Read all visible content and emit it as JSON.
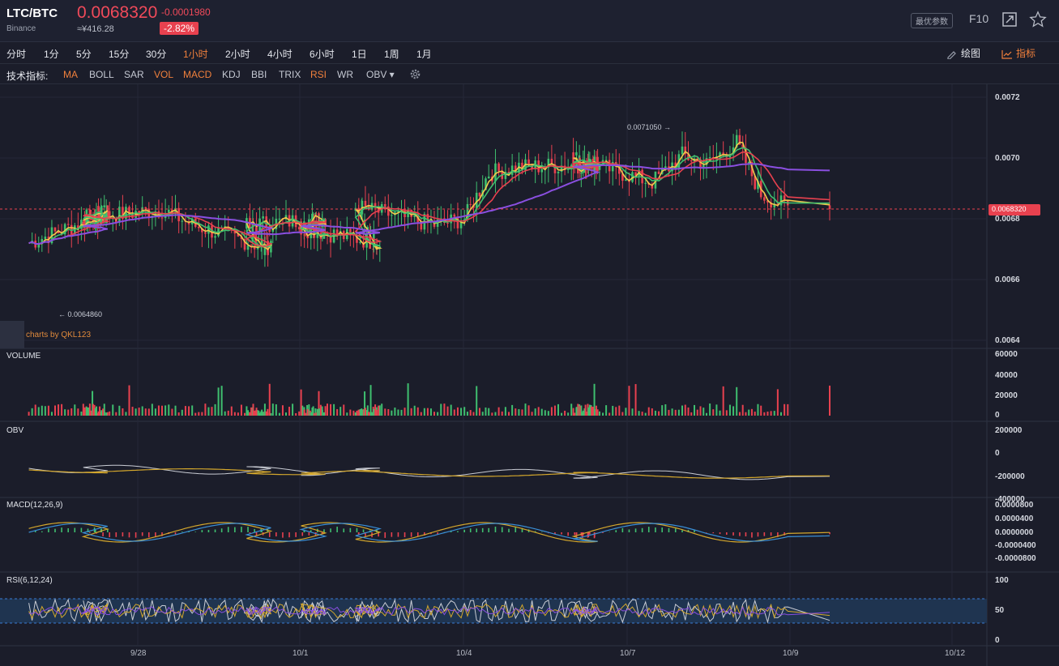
{
  "header": {
    "pair": "LTC/BTC",
    "exchange": "Binance",
    "price": "0.0068320",
    "cny_price": "≈¥416.28",
    "change_abs": "-0.0001980",
    "change_pct": "-2.82%",
    "params_label": "最优参数",
    "f10_label": "F10",
    "icons": [
      "expand-icon",
      "star-icon"
    ]
  },
  "timeframes": [
    {
      "label": "分时",
      "active": false
    },
    {
      "label": "1分",
      "active": false
    },
    {
      "label": "5分",
      "active": false
    },
    {
      "label": "15分",
      "active": false
    },
    {
      "label": "30分",
      "active": false
    },
    {
      "label": "1小时",
      "active": true
    },
    {
      "label": "2小时",
      "active": false
    },
    {
      "label": "4小时",
      "active": false
    },
    {
      "label": "6小时",
      "active": false
    },
    {
      "label": "1日",
      "active": false
    },
    {
      "label": "1周",
      "active": false
    },
    {
      "label": "1月",
      "active": false
    }
  ],
  "tools": {
    "draw_label": "绘图",
    "indicator_label": "指标",
    "draw_icon": "pencil-icon",
    "indicator_icon": "chart-line-icon"
  },
  "indicators": {
    "label": "技术指标:",
    "items": [
      {
        "name": "MA",
        "on": true
      },
      {
        "name": "BOLL",
        "on": false
      },
      {
        "name": "SAR",
        "on": false
      },
      {
        "name": "VOL",
        "on": true
      },
      {
        "name": "MACD",
        "on": true
      },
      {
        "name": "KDJ",
        "on": false
      },
      {
        "name": "BBI",
        "on": false
      },
      {
        "name": "TRIX",
        "on": false
      },
      {
        "name": "RSI",
        "on": true
      },
      {
        "name": "WR",
        "on": false
      },
      {
        "name": "OBV ▾",
        "on": false
      }
    ],
    "settings_icon": "gear-icon"
  },
  "main_chart": {
    "price_axis": [
      "0.0072",
      "0.0070",
      "0.0068",
      "0.0066",
      "0.0064"
    ],
    "current_price_tag": "0.0068320",
    "high_annotation": "0.0071050 →",
    "low_annotation": "← 0.0064860",
    "brand": "charts by QKL123",
    "colors": {
      "up": "#3fbf6f",
      "down": "#e8414f",
      "ma_fast": "#f2c94c",
      "ma_mid": "#3fbf6f",
      "ma_slow": "#e8414f",
      "ma_long": "#8a4fe0"
    }
  },
  "volume_panel": {
    "label": "VOLUME",
    "axis": [
      "60000",
      "40000",
      "20000",
      "0"
    ]
  },
  "obv_panel": {
    "label": "OBV",
    "axis": [
      "200000",
      "0",
      "-200000",
      "-400000"
    ]
  },
  "macd_panel": {
    "label": "MACD(12,26,9)",
    "axis": [
      "0.0000800",
      "0.0000400",
      "0.0000000",
      "-0.0000400",
      "-0.0000800"
    ]
  },
  "rsi_panel": {
    "label": "RSI(6,12,24)",
    "axis": [
      "100",
      "50",
      "0"
    ]
  },
  "dates": [
    "9/28",
    "10/1",
    "10/4",
    "10/7",
    "10/9",
    "10/12"
  ],
  "chart_data": {
    "type": "candlestick",
    "title": "LTC/BTC",
    "interval": "1小时",
    "price_ylim": [
      0.0064,
      0.0072
    ],
    "x_ticks": [
      "9/28",
      "10/1",
      "10/4",
      "10/7",
      "10/9",
      "10/12"
    ],
    "close_trajectory": [
      {
        "x": "9/26",
        "y": 0.00672
      },
      {
        "x": "9/27",
        "y": 0.00682
      },
      {
        "x": "9/27",
        "y": 0.0068
      },
      {
        "x": "9/28",
        "y": 0.00683
      },
      {
        "x": "9/29",
        "y": 0.00678
      },
      {
        "x": "9/30",
        "y": 0.0067
      },
      {
        "x": "9/30",
        "y": 0.00678
      },
      {
        "x": "10/1",
        "y": 0.0068
      },
      {
        "x": "10/1",
        "y": 0.00677
      },
      {
        "x": "10/2",
        "y": 0.00672
      },
      {
        "x": "10/2",
        "y": 0.00684
      },
      {
        "x": "10/3",
        "y": 0.00678
      },
      {
        "x": "10/4",
        "y": 0.0068
      },
      {
        "x": "10/4",
        "y": 0.00695
      },
      {
        "x": "10/5",
        "y": 0.00697
      },
      {
        "x": "10/6",
        "y": 0.00698
      },
      {
        "x": "10/6",
        "y": 0.007
      },
      {
        "x": "10/7",
        "y": 0.00692
      },
      {
        "x": "10/8",
        "y": 0.00701
      },
      {
        "x": "10/8",
        "y": 0.00698
      },
      {
        "x": "10/9",
        "y": 0.00705
      },
      {
        "x": "10/9",
        "y": 0.00688
      },
      {
        "x": "10/10",
        "y": 0.006832
      }
    ],
    "high": 0.007105,
    "low": 0.006486,
    "last": 0.006832
  }
}
